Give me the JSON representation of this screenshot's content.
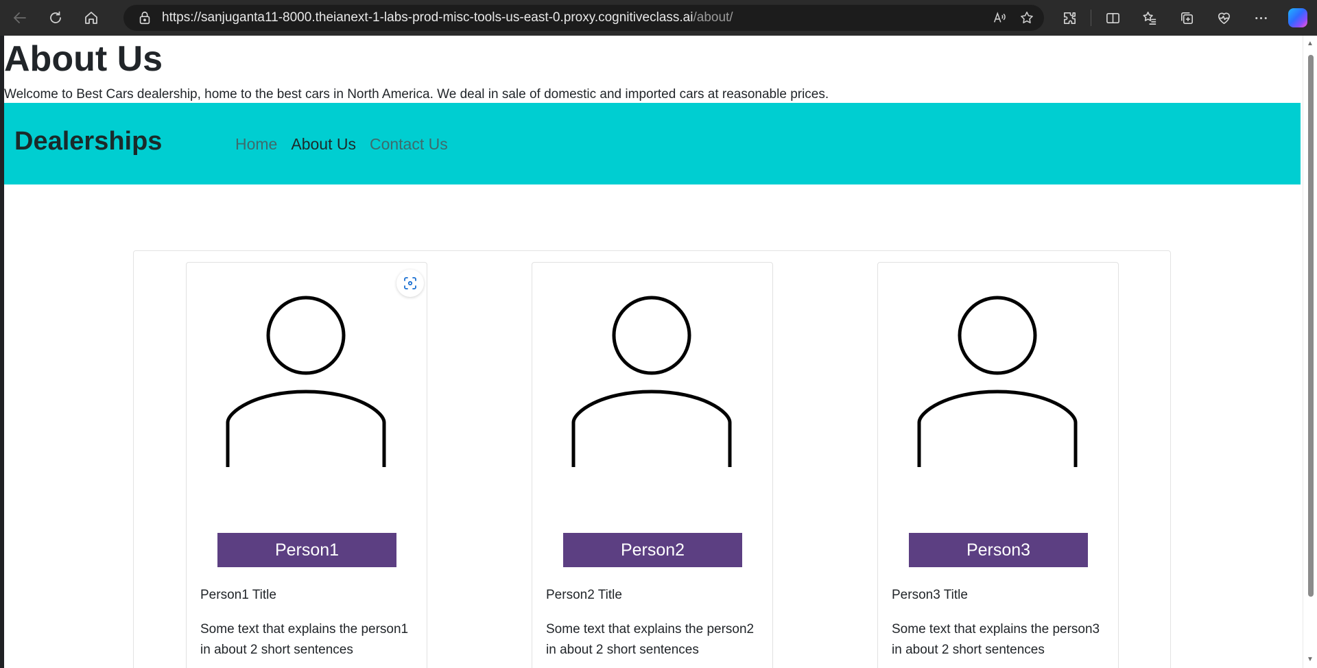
{
  "browser": {
    "url_host": "https://sanjuganta11-8000.theianext-1-labs-prod-misc-tools-us-east-0.proxy.cognitiveclass.ai",
    "url_path": "/about/"
  },
  "page": {
    "title": "About Us",
    "intro": "Welcome to Best Cars dealership, home to the best cars in North America. We deal in sale of domestic and imported cars at reasonable prices."
  },
  "navbar": {
    "brand": "Dealerships",
    "links": [
      {
        "label": "Home",
        "active": false
      },
      {
        "label": "About Us",
        "active": true
      },
      {
        "label": "Contact Us",
        "active": false
      }
    ]
  },
  "team": [
    {
      "name": "Person1",
      "title": "Person1 Title",
      "description": "Some text that explains the person1 in about 2 short sentences"
    },
    {
      "name": "Person2",
      "title": "Person2 Title",
      "description": "Some text that explains the person2 in about 2 short sentences"
    },
    {
      "name": "Person3",
      "title": "Person3 Title",
      "description": "Some text that explains the person3 in about 2 short sentences"
    }
  ],
  "colors": {
    "navbar_bg": "#00ced1",
    "badge_bg": "#5c3f82"
  }
}
